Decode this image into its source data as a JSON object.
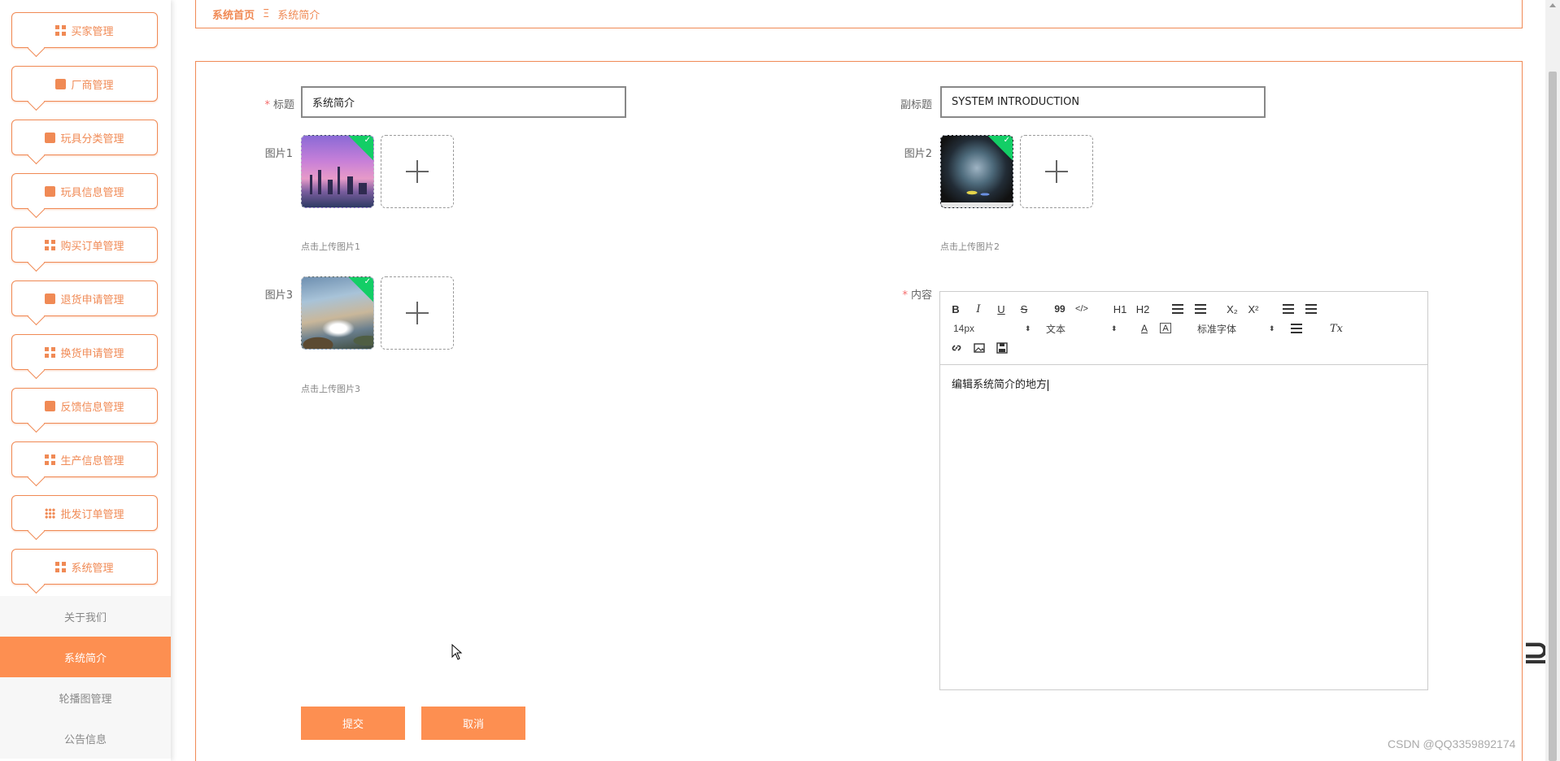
{
  "sidebar": {
    "items": [
      {
        "label": "买家管理",
        "icon": "grid-icon"
      },
      {
        "label": "厂商管理",
        "icon": "thumb-icon"
      },
      {
        "label": "玩具分类管理",
        "icon": "book-icon"
      },
      {
        "label": "玩具信息管理",
        "icon": "clipboard-icon"
      },
      {
        "label": "购买订单管理",
        "icon": "grid-icon"
      },
      {
        "label": "退货申请管理",
        "icon": "chart-icon"
      },
      {
        "label": "换货申请管理",
        "icon": "grid-icon"
      },
      {
        "label": "反馈信息管理",
        "icon": "clipboard-check-icon"
      },
      {
        "label": "生产信息管理",
        "icon": "grid-icon"
      },
      {
        "label": "批发订单管理",
        "icon": "apps-icon"
      },
      {
        "label": "系统管理",
        "icon": "grid-icon"
      }
    ],
    "submenu": [
      {
        "label": "关于我们"
      },
      {
        "label": "系统简介"
      },
      {
        "label": "轮播图管理"
      },
      {
        "label": "公告信息"
      }
    ]
  },
  "breadcrumb": {
    "home": "系统首页",
    "separator": "Ξ",
    "current": "系统简介"
  },
  "form": {
    "title_label": "标题",
    "title_value": "系统简介",
    "subtitle_label": "副标题",
    "subtitle_value": "SYSTEM INTRODUCTION",
    "image1_label": "图片1",
    "image1_hint": "点击上传图片1",
    "image2_label": "图片2",
    "image2_hint": "点击上传图片2",
    "image3_label": "图片3",
    "image3_hint": "点击上传图片3",
    "content_label": "内容",
    "required_mark": "*"
  },
  "editor": {
    "toolbar": {
      "bold": "B",
      "italic": "I",
      "underline": "U",
      "strike": "S",
      "quote": "99",
      "code": "</>",
      "h1": "H1",
      "h2": "H2",
      "sub": "X₂",
      "sup": "X²",
      "size": "14px",
      "header": "文本",
      "font": "标准字体",
      "font_color": "A",
      "clean": "Tx"
    },
    "content": "编辑系统简介的地方"
  },
  "buttons": {
    "submit": "提交",
    "cancel": "取消"
  },
  "watermark": "CSDN @QQ3359892174",
  "colors": {
    "accent": "#fd8f51",
    "border": "#f08a55",
    "success": "#13ce66",
    "required": "#f56c6c"
  }
}
